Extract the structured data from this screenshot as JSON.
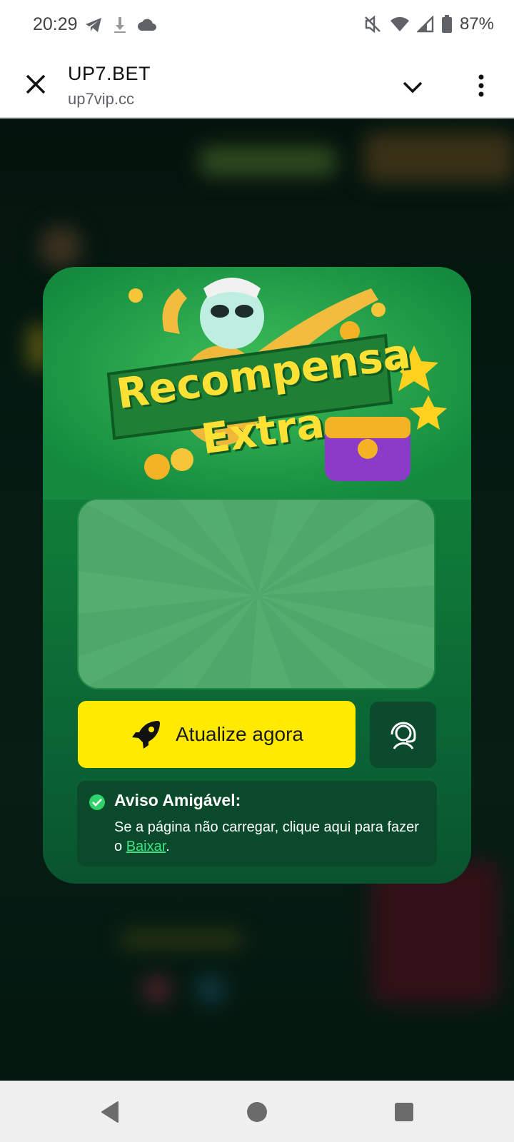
{
  "status_bar": {
    "time": "20:29",
    "battery": "87%",
    "left_icons": [
      "telegram-icon",
      "download-icon",
      "cloud-icon"
    ],
    "right_icons": [
      "vibrate-off-icon",
      "wifi-icon",
      "signal-icon",
      "battery-icon"
    ]
  },
  "toolbar": {
    "title": "UP7.BET",
    "url": "up7vip.cc"
  },
  "modal": {
    "banner_line1": "Recompensa",
    "banner_line2": "Extra",
    "update_button": "Atualize agora",
    "notice_title": "Aviso Amigável:",
    "notice_text_before": "Se a página não carregar, clique aqui para fazer o ",
    "notice_link": "Baixar",
    "notice_text_after": "."
  },
  "colors": {
    "card_green": "#0f7a38",
    "button_yellow": "#ffea00",
    "link_green": "#3ee383"
  }
}
